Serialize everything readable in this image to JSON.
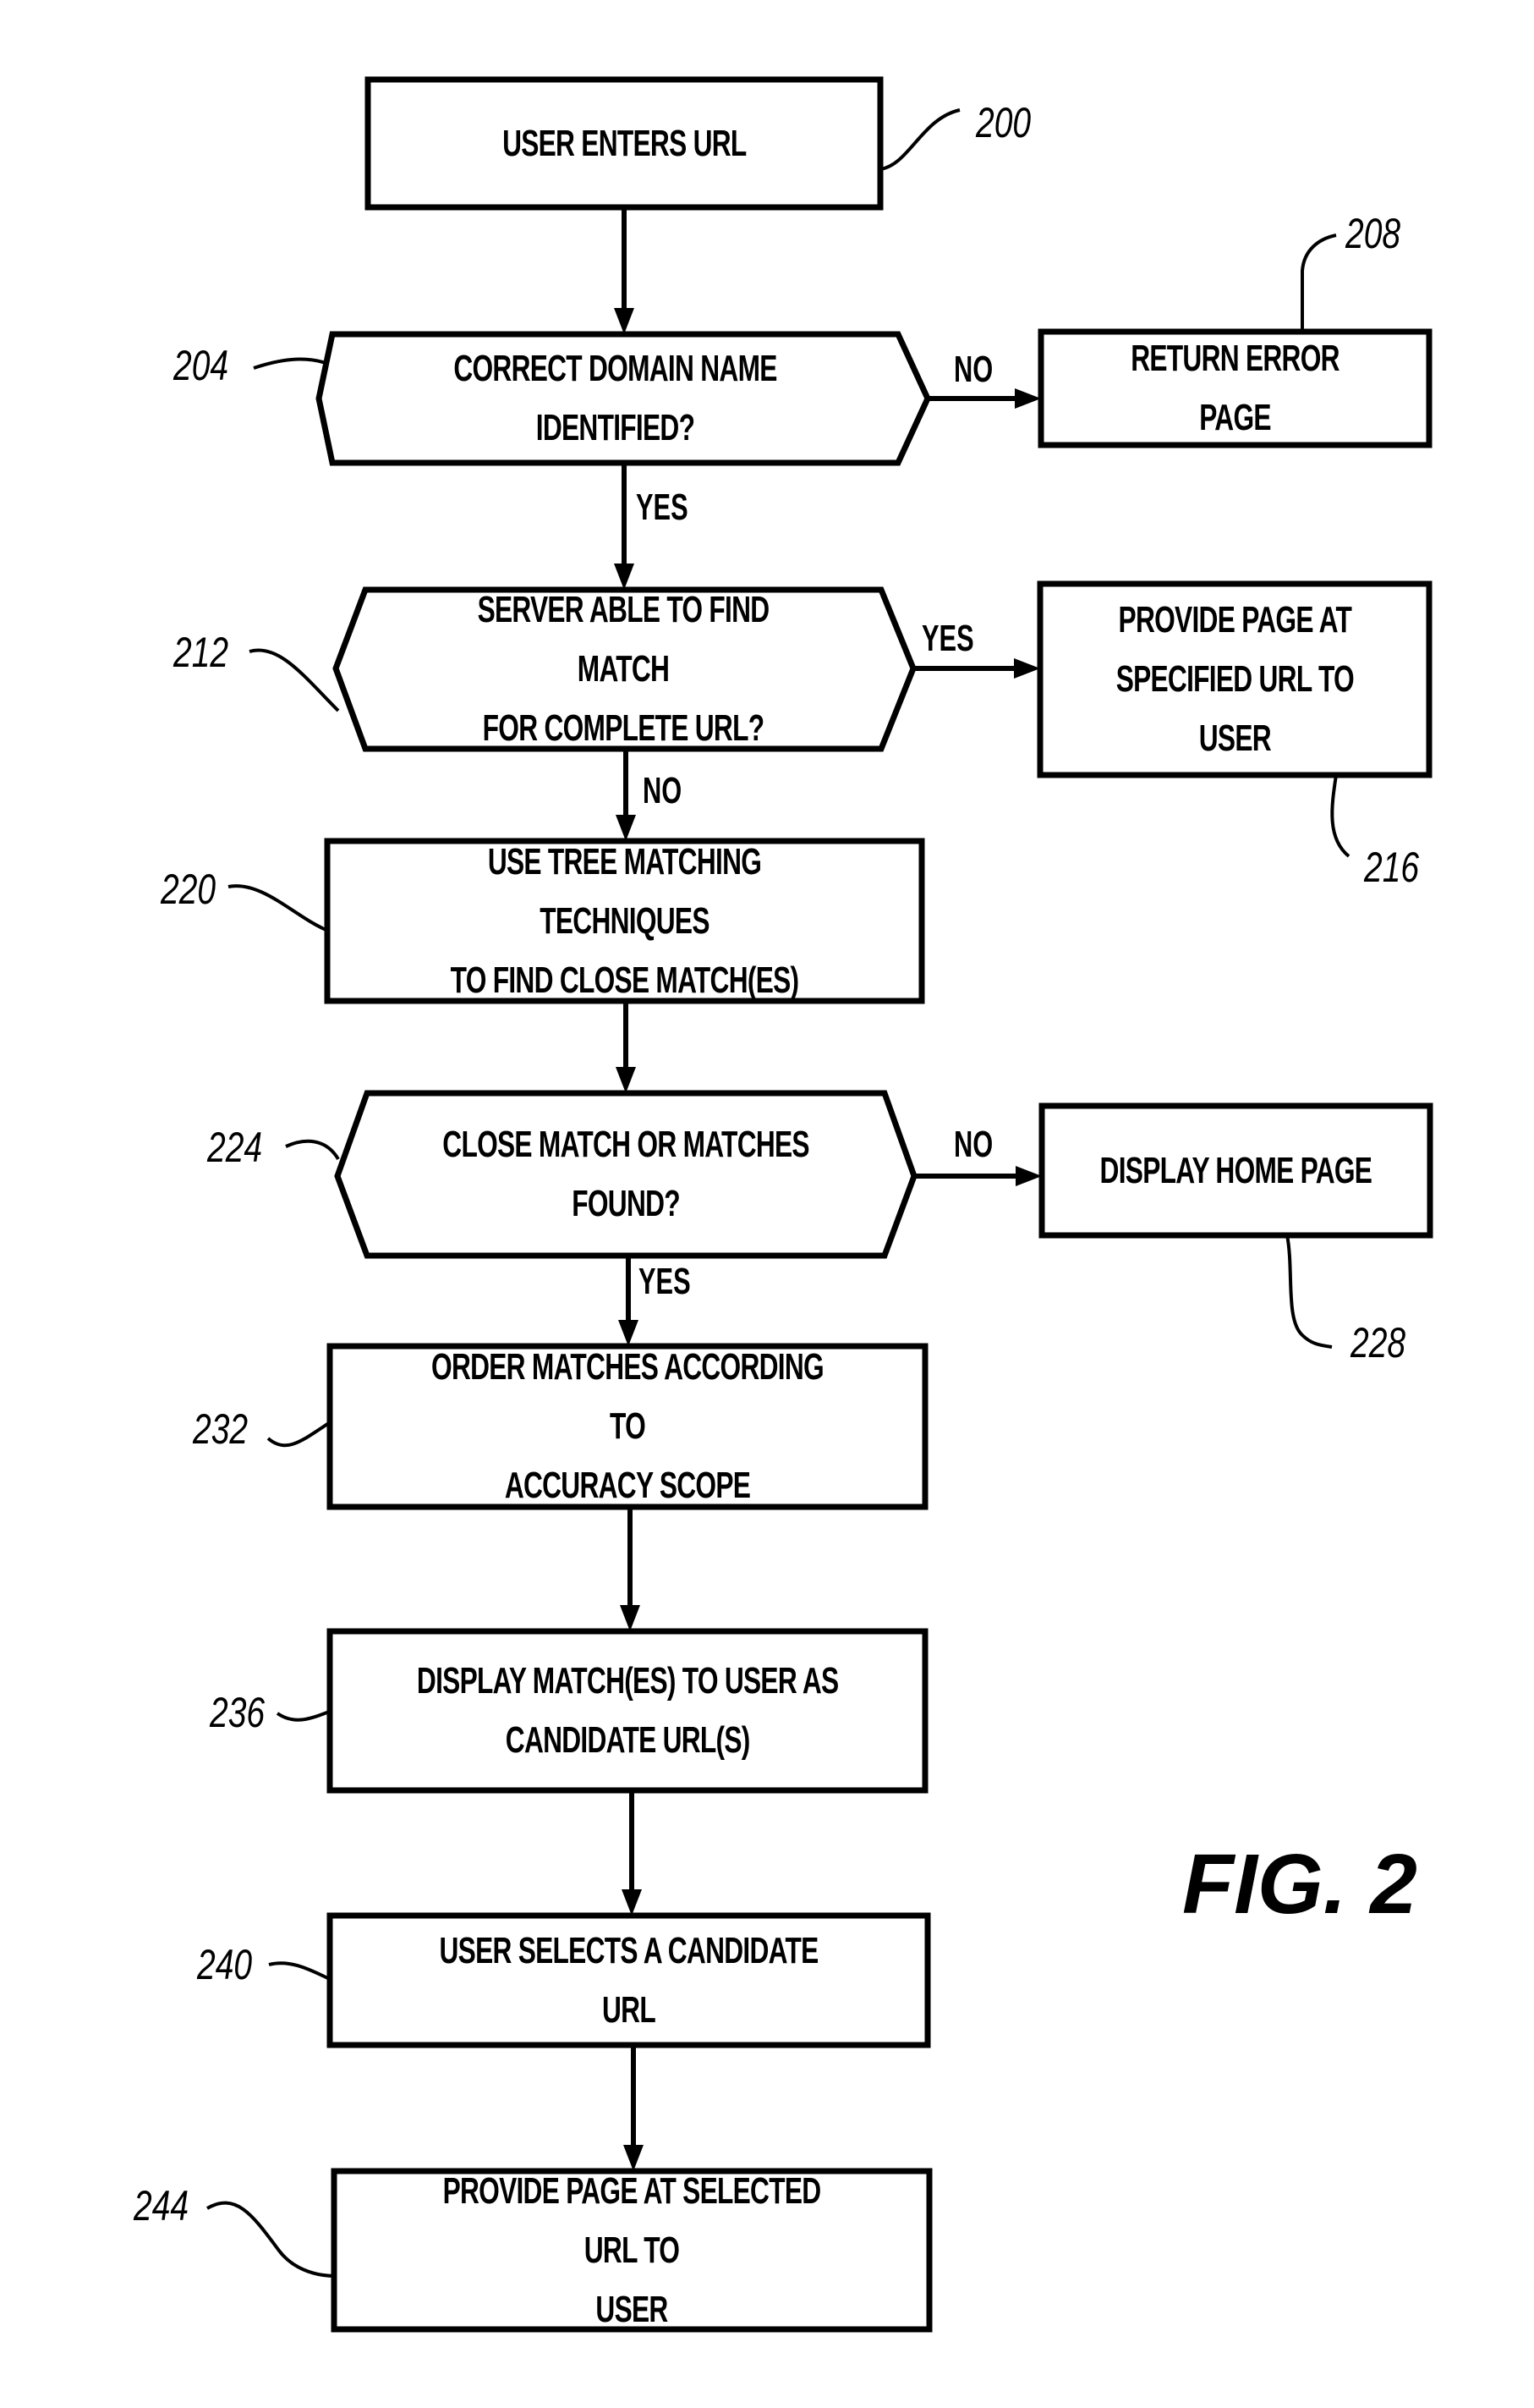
{
  "figure_label": "FIG. 2",
  "nodes": {
    "n200": {
      "ref": "200",
      "text": "USER ENTERS URL",
      "type": "process"
    },
    "n204": {
      "ref": "204",
      "text": "CORRECT DOMAIN NAME IDENTIFIED?",
      "type": "decision"
    },
    "n208": {
      "ref": "208",
      "text": "RETURN ERROR PAGE",
      "type": "process"
    },
    "n212": {
      "ref": "212",
      "text": "SERVER ABLE TO FIND MATCH\nFOR COMPLETE URL?",
      "type": "decision"
    },
    "n216": {
      "ref": "216",
      "text": "PROVIDE PAGE AT\nSPECIFIED URL TO\nUSER",
      "type": "process"
    },
    "n220": {
      "ref": "220",
      "text": "USE TREE MATCHING TECHNIQUES\nTO FIND CLOSE MATCH(ES)",
      "type": "process"
    },
    "n224": {
      "ref": "224",
      "text": "CLOSE MATCH OR MATCHES\nFOUND?",
      "type": "decision"
    },
    "n228": {
      "ref": "228",
      "text": "DISPLAY HOME PAGE",
      "type": "process"
    },
    "n232": {
      "ref": "232",
      "text": "ORDER MATCHES ACCORDING TO\nACCURACY SCOPE",
      "type": "process"
    },
    "n236": {
      "ref": "236",
      "text": "DISPLAY MATCH(ES) TO USER AS\nCANDIDATE URL(S)",
      "type": "process"
    },
    "n240": {
      "ref": "240",
      "text": "USER SELECTS A CANDIDATE URL",
      "type": "process"
    },
    "n244": {
      "ref": "244",
      "text": "PROVIDE PAGE AT SELECTED URL TO\nUSER",
      "type": "process"
    }
  },
  "edges": [
    {
      "from": "200",
      "to": "204",
      "label": ""
    },
    {
      "from": "204",
      "to": "208",
      "label": "NO"
    },
    {
      "from": "204",
      "to": "212",
      "label": "YES"
    },
    {
      "from": "212",
      "to": "216",
      "label": "YES"
    },
    {
      "from": "212",
      "to": "220",
      "label": "NO"
    },
    {
      "from": "220",
      "to": "224",
      "label": ""
    },
    {
      "from": "224",
      "to": "228",
      "label": "NO"
    },
    {
      "from": "224",
      "to": "232",
      "label": "YES"
    },
    {
      "from": "232",
      "to": "236",
      "label": ""
    },
    {
      "from": "236",
      "to": "240",
      "label": ""
    },
    {
      "from": "240",
      "to": "244",
      "label": ""
    }
  ],
  "branch_labels": {
    "e204_208": "NO",
    "e204_212": "YES",
    "e212_216": "YES",
    "e212_220": "NO",
    "e224_228": "NO",
    "e224_232": "YES"
  }
}
